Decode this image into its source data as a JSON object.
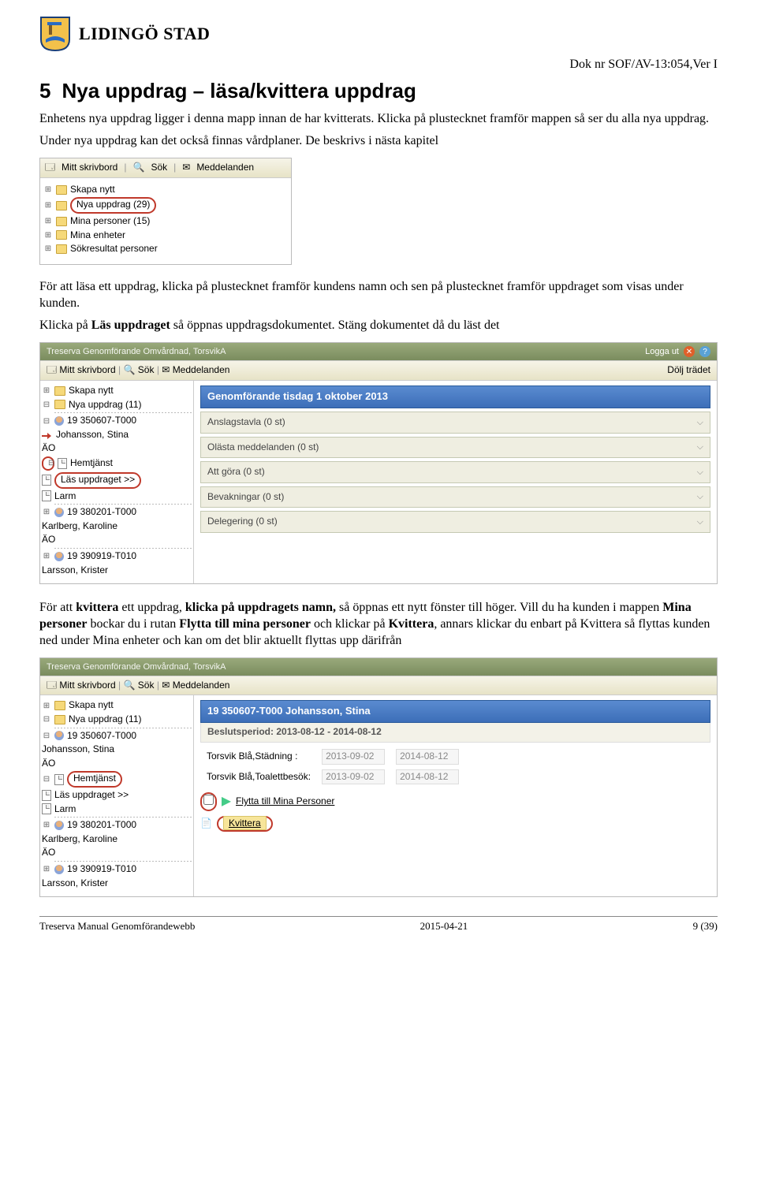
{
  "header": {
    "brand_text": "LIDINGÖ STAD",
    "doc_nr": "Dok nr SOF/AV-13:054,Ver I"
  },
  "section": {
    "number": "5",
    "title": "Nya uppdrag – läsa/kvittera uppdrag"
  },
  "para1": "Enhetens nya uppdrag ligger i denna mapp innan de har kvitterats. Klicka på plustecknet framför mappen så ser du alla nya uppdrag.",
  "para2": "Under nya uppdrag kan det också finnas vårdplaner. De beskrivs i nästa kapitel",
  "shot1": {
    "toolbar": {
      "mitt": "Mitt skrivbord",
      "sok": "Sök",
      "medd": "Meddelanden"
    },
    "items": {
      "skapa": "Skapa nytt",
      "nya": "Nya uppdrag (29)",
      "mina_p": "Mina personer (15)",
      "mina_e": "Mina enheter",
      "sokres": "Sökresultat personer"
    }
  },
  "para3a": "För att läsa ett uppdrag, klicka på plustecknet framför kundens namn och sen på plustecknet framför uppdraget som visas under kunden.",
  "para3b_pre": "Klicka på ",
  "para3b_bold": "Läs uppdraget",
  "para3b_post": " så öppnas uppdragsdokumentet. Stäng dokumentet då du läst det",
  "shot2": {
    "appbar_title": "Treserva Genomförande Omvårdnad, TorsvikA",
    "logga_ut": "Logga ut",
    "dolj": "Dölj trädet",
    "toolbar": {
      "mitt": "Mitt skrivbord",
      "sok": "Sök",
      "medd": "Meddelanden"
    },
    "tree": {
      "skapa": "Skapa nytt",
      "nya": "Nya uppdrag (11)",
      "p1_id": "19 350607-T000",
      "p1_name": "Johansson, Stina",
      "p1_sub": "ÄO",
      "hemtjanst": "Hemtjänst",
      "las": "Läs uppdraget >>",
      "larm": "Larm",
      "p2_id": "19 380201-T000",
      "p2_name": "Karlberg, Karoline",
      "p2_sub": "ÄO",
      "p3_id": "19 390919-T010",
      "p3_name": "Larsson, Krister"
    },
    "content": {
      "title": "Genomförande tisdag 1 oktober 2013",
      "rows": {
        "anslag": "Anslagstavla (0 st)",
        "olasta": "Olästa meddelanden (0 st)",
        "attgora": "Att göra (0 st)",
        "bevak": "Bevakningar (0 st)",
        "deleg": "Delegering (0 st)"
      }
    }
  },
  "para4_parts": {
    "a": "För att ",
    "b": "kvittera",
    "c": " ett uppdrag, ",
    "d": "klicka på uppdragets namn,",
    "e": " så öppnas ett nytt fönster till höger. Vill du ha kunden i mappen ",
    "f": "Mina personer",
    "g": " bockar du i rutan ",
    "h": "Flytta till mina personer",
    "i": " och klickar på ",
    "j": "Kvittera",
    "k": ", annars klickar du enbart på Kvittera så flyttas kunden ned under Mina enheter och kan om det blir aktuellt flyttas upp därifrån"
  },
  "shot3": {
    "appbar_title": "Treserva Genomförande Omvårdnad, TorsvikA",
    "toolbar": {
      "mitt": "Mitt skrivbord",
      "sok": "Sök",
      "medd": "Meddelanden"
    },
    "tree": {
      "skapa": "Skapa nytt",
      "nya": "Nya uppdrag (11)",
      "p1_id": "19 350607-T000",
      "p1_name": "Johansson, Stina",
      "p1_sub": "ÄO",
      "hemtjanst": "Hemtjänst",
      "las": "Läs uppdraget >>",
      "larm": "Larm",
      "p2_id": "19 380201-T000",
      "p2_name": "Karlberg, Karoline",
      "p2_sub": "ÄO",
      "p3_id": "19 390919-T010",
      "p3_name": "Larsson, Krister"
    },
    "content": {
      "title": "19 350607-T000 Johansson, Stina",
      "period_label": "Beslutsperiod: 2013-08-12 - 2014-08-12",
      "svc1_label": "Torsvik Blå,Städning",
      "svc2_label": "Torsvik Blå,Toalettbesök:",
      "date1": "2013-09-02",
      "date2": "2014-08-12",
      "flytta": "Flytta till Mina Personer",
      "kvittera": "Kvittera"
    }
  },
  "footer": {
    "left": "Treserva Manual Genomförandewebb",
    "center": "2015-04-21",
    "right": "9 (39)"
  }
}
